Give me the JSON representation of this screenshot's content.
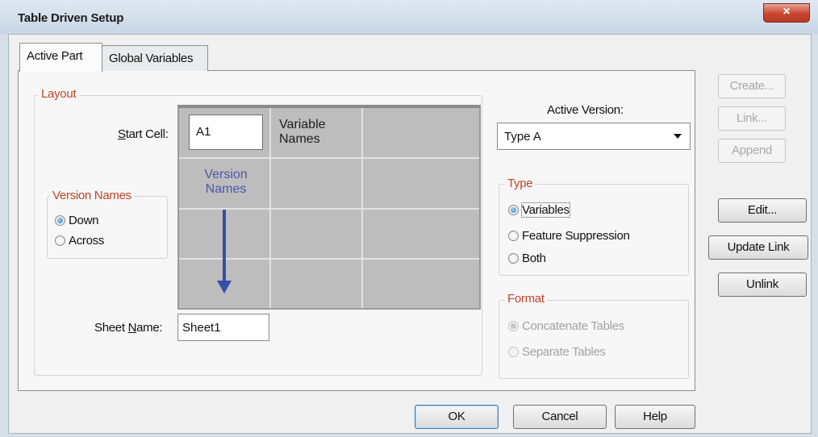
{
  "window": {
    "title": "Table Driven Setup",
    "close_glyph": "×"
  },
  "tabs": [
    {
      "label": "Active Part",
      "selected": true
    },
    {
      "label": "Global Variables",
      "selected": false
    }
  ],
  "layout": {
    "legend": "Layout",
    "start_cell_label": "Start Cell:",
    "start_cell_value": "A1",
    "variable_names_line1": "Variable",
    "variable_names_line2": "Names",
    "version_names_line1": "Version",
    "version_names_line2": "Names",
    "arrow_icon": "arrow-down-icon",
    "sheet_name_label": "Sheet Name:",
    "sheet_name_value": "Sheet1"
  },
  "version_names": {
    "legend": "Version Names",
    "options": [
      {
        "label": "Down",
        "selected": true
      },
      {
        "label": "Across",
        "selected": false
      }
    ]
  },
  "active_version": {
    "label": "Active Version:",
    "value": "Type A"
  },
  "type_group": {
    "legend": "Type",
    "options": [
      {
        "label": "Variables",
        "selected": true
      },
      {
        "label": "Feature Suppression",
        "selected": false
      },
      {
        "label": "Both",
        "selected": false
      }
    ]
  },
  "format_group": {
    "legend": "Format",
    "options": [
      {
        "label": "Concatenate Tables",
        "selected": true
      },
      {
        "label": "Separate Tables",
        "selected": false
      }
    ]
  },
  "side_buttons": {
    "create": "Create...",
    "link": "Link...",
    "append": "Append",
    "edit": "Edit...",
    "update_link": "Update Link",
    "unlink": "Unlink"
  },
  "bottom_buttons": {
    "ok": "OK",
    "cancel": "Cancel",
    "help": "Help"
  },
  "colors": {
    "legend": "#c0442c",
    "arrow": "#3450a8",
    "radio_selected": "#2a7fc7"
  }
}
